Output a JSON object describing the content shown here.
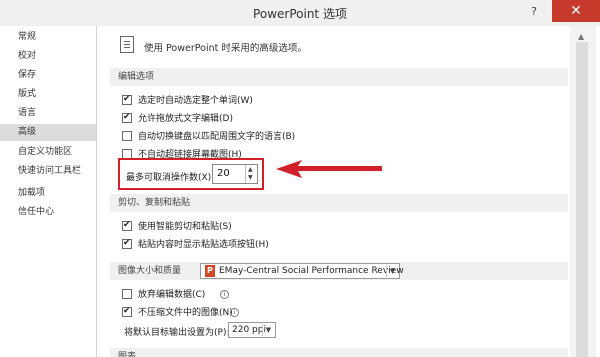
{
  "window": {
    "title": "PowerPoint 选项",
    "help_label": "?",
    "close_label": "✕"
  },
  "sidebar": {
    "items": [
      {
        "label": "常规"
      },
      {
        "label": "校对"
      },
      {
        "label": "保存"
      },
      {
        "label": "版式"
      },
      {
        "label": "语言"
      },
      {
        "label": "高级",
        "active": true
      },
      {
        "label": "自定义功能区"
      },
      {
        "label": "快速访问工具栏"
      },
      {
        "label": "加载项"
      },
      {
        "label": "信任中心"
      }
    ]
  },
  "header": {
    "text": "使用 PowerPoint 时采用的高级选项。",
    "icon": "document-settings-icon"
  },
  "sections": {
    "editing": "编辑选项",
    "cut_copy_paste": "剪切、复制和粘贴",
    "image_size_quality": "图像大小和质量",
    "chart": "图表"
  },
  "editing_options": [
    {
      "label": "选定时自动选定整个单词(W)",
      "checked": true
    },
    {
      "label": "允许拖放式文字编辑(D)",
      "checked": true
    },
    {
      "label": "自动切换键盘以匹配周围文字的语言(B)",
      "checked": false
    },
    {
      "label": "不自动超链接屏幕截图(H)",
      "checked": false
    }
  ],
  "undo": {
    "label": "最多可取消操作数(X):",
    "value": "20"
  },
  "paste_options": [
    {
      "label": "使用智能剪切和粘贴(S)",
      "checked": true
    },
    {
      "label": "粘贴内容时显示粘贴选项按钮(H)",
      "checked": true
    }
  ],
  "image_quality": {
    "presentation": "EMay-Central Social Performance Review",
    "discard_edit": {
      "label": "放弃编辑数据(C)",
      "checked": false
    },
    "no_compress": {
      "label": "不压缩文件中的图像(N)",
      "checked": true
    },
    "default_resolution_label": "将默认目标输出设置为(P):",
    "default_resolution": "220 ppi"
  },
  "colors": {
    "highlight": "#d0202a",
    "close_button": "#c7392a"
  }
}
